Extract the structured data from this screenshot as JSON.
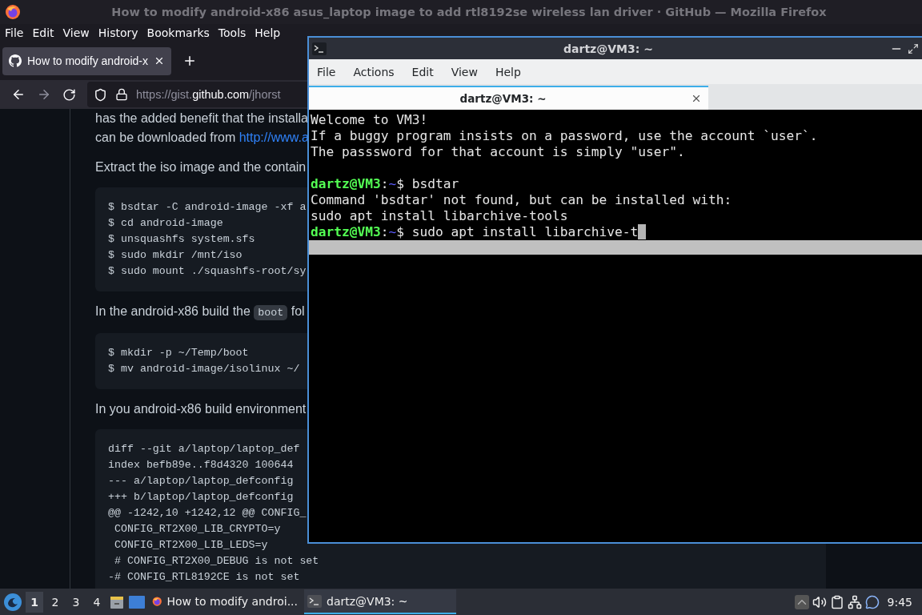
{
  "browser": {
    "title": "How to modify android-x86 asus_laptop image to add rtl8192se wireless lan driver · GitHub — Mozilla Firefox",
    "menu": [
      "File",
      "Edit",
      "View",
      "History",
      "Bookmarks",
      "Tools",
      "Help"
    ],
    "tabs": [
      {
        "label": "How to modify android-x",
        "selected": true
      }
    ],
    "url": {
      "prefix": "https://gist.",
      "domain": "github.com",
      "path": "/jhorst"
    },
    "content": [
      {
        "kind": "paragraph",
        "text": "has the added benefit that the installa\ncan be downloaded from ",
        "link": "http://www.a"
      },
      {
        "kind": "paragraph",
        "text": "Extract the iso image and the contain"
      },
      {
        "kind": "code",
        "lines": [
          "$ bsdtar -C android-image -xf a",
          "$ cd android-image",
          "$ unsquashfs system.sfs",
          "$ sudo mkdir /mnt/iso",
          "$ sudo mount ./squashfs-root/sy"
        ]
      },
      {
        "kind": "paragraph",
        "text": "In the android-x86 build the ",
        "code": "boot",
        "after": " fol"
      },
      {
        "kind": "code",
        "lines": [
          "$ mkdir -p ~/Temp/boot",
          "$ mv android-image/isolinux ~/"
        ]
      },
      {
        "kind": "paragraph",
        "text": "In you android-x86 build environment"
      },
      {
        "kind": "code",
        "lines": [
          "diff --git a/laptop/laptop_def",
          "index befb89e..f8d4320 100644",
          "--- a/laptop/laptop_defconfig",
          "+++ b/laptop/laptop_defconfig",
          "@@ -1242,10 +1242,12 @@ CONFIG_",
          " CONFIG_RT2X00_LIB_CRYPTO=y",
          " CONFIG_RT2X00_LIB_LEDS=y",
          " # CONFIG_RT2X00_DEBUG is not set",
          "-# CONFIG_RTL8192CE is not set"
        ]
      }
    ]
  },
  "terminal": {
    "title": "dartz@VM3: ~",
    "menu": [
      "File",
      "Actions",
      "Edit",
      "View",
      "Help"
    ],
    "tabs": [
      {
        "label": "dartz@VM3: ~",
        "selected": true
      }
    ],
    "lines": [
      {
        "kind": "output",
        "text": "Welcome to VM3!"
      },
      {
        "kind": "output",
        "text": "If a buggy program insists on a password, use the account `user`."
      },
      {
        "kind": "output",
        "text": "The passsword for that account is simply \"user\"."
      },
      {
        "kind": "blank"
      },
      {
        "kind": "prompt",
        "user": "dartz@VM3",
        "sep": ":",
        "path": "~",
        "symbol": "$",
        "command": "bsdtar",
        "cursor": false
      },
      {
        "kind": "output",
        "text": "Command 'bsdtar' not found, but can be installed with:"
      },
      {
        "kind": "output",
        "text": "sudo apt install libarchive-tools"
      },
      {
        "kind": "prompt",
        "user": "dartz@VM3",
        "sep": ":",
        "path": "~",
        "symbol": "$",
        "command": "sudo apt install libarchive-t",
        "cursor": true
      }
    ]
  },
  "taskbar": {
    "workspaces": [
      {
        "label": "1",
        "selected": true
      },
      {
        "label": "2",
        "selected": false
      },
      {
        "label": "3",
        "selected": false
      },
      {
        "label": "4",
        "selected": false
      }
    ],
    "tasks": [
      {
        "kind": "browser",
        "label": "How to modify androi...",
        "selected": false
      },
      {
        "kind": "terminal",
        "label": "dartz@VM3: ~",
        "selected": true
      }
    ],
    "clock": "9:45"
  }
}
